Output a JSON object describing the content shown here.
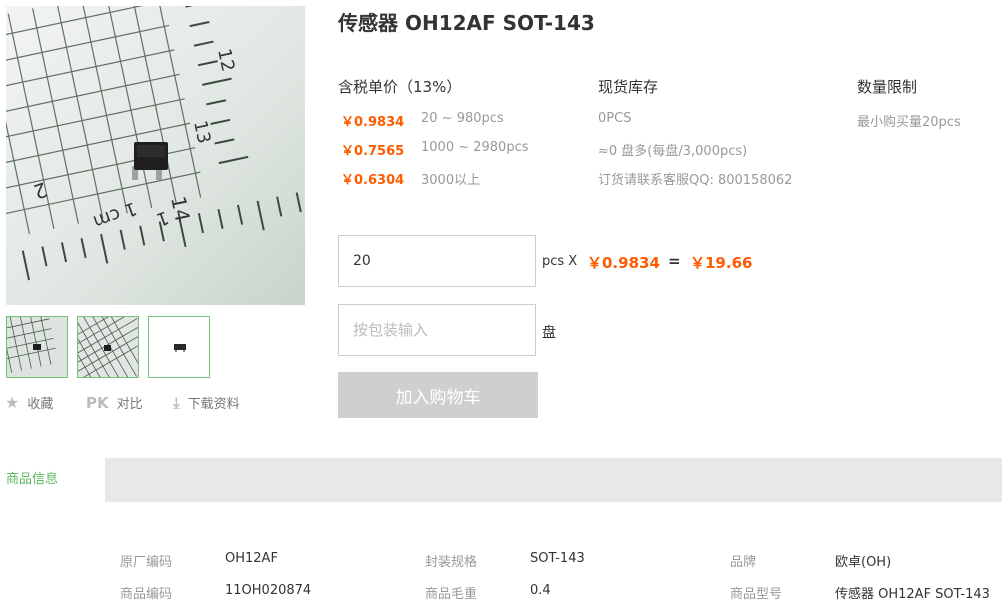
{
  "product": {
    "title": "传感器 OH12AF SOT-143"
  },
  "actions": {
    "favorite": "收藏",
    "compare_prefix": "PK",
    "compare": "对比",
    "download": "下载资料"
  },
  "pricing": {
    "header": "含税单价（13%）",
    "tiers": [
      {
        "price": "￥0.9834",
        "range": "20 ~ 980pcs"
      },
      {
        "price": "￥0.7565",
        "range": "1000 ~ 2980pcs"
      },
      {
        "price": "￥0.6304",
        "range": "3000以上"
      }
    ]
  },
  "stock": {
    "header": "现货库存",
    "lines": [
      "0PCS",
      "≈0 盘多(每盘/3,000pcs)",
      "订货请联系客服QQ: 800158062"
    ]
  },
  "limit": {
    "header": "数量限制",
    "line": "最小购买量20pcs"
  },
  "order": {
    "quantity_value": "20",
    "unit_label": "pcs X",
    "unit_price": "￥0.9834",
    "equals": "=",
    "total": "￥19.66",
    "package_placeholder": "按包装输入",
    "package_unit": "盘",
    "add_to_cart": "加入购物车"
  },
  "tabs": {
    "active": "商品信息"
  },
  "specs": [
    {
      "label": "原厂编码",
      "value": "OH12AF"
    },
    {
      "label": "封装规格",
      "value": "SOT-143"
    },
    {
      "label": "品牌",
      "value": "欧卓(OH)"
    },
    {
      "label": "商品编码",
      "value": "11OH020874"
    },
    {
      "label": "商品毛重",
      "value": "0.4"
    },
    {
      "label": "商品型号",
      "value": "传感器 OH12AF SOT-143"
    }
  ],
  "image_ruler_labels": [
    "12",
    "13",
    "14",
    "2",
    "1 cm",
    "1"
  ]
}
